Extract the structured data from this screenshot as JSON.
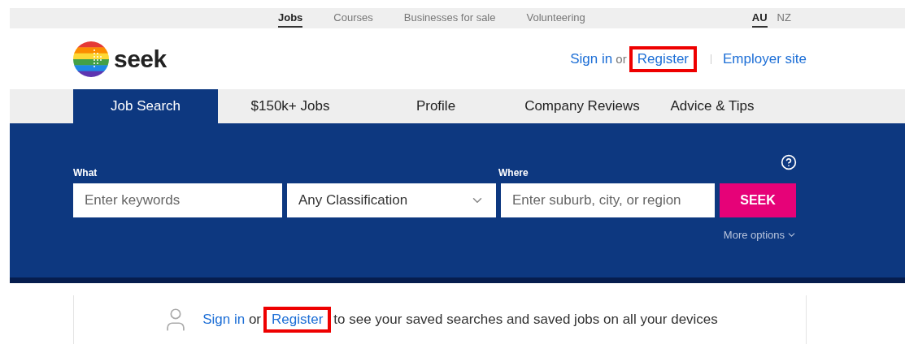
{
  "top_nav": {
    "items": [
      {
        "label": "Jobs",
        "selected": true
      },
      {
        "label": "Courses",
        "selected": false
      },
      {
        "label": "Businesses for sale",
        "selected": false
      },
      {
        "label": "Volunteering",
        "selected": false
      }
    ],
    "regions": [
      {
        "label": "AU",
        "selected": true
      },
      {
        "label": "NZ",
        "selected": false
      }
    ]
  },
  "header": {
    "logo": "seek",
    "sign_in": "Sign in",
    "or": "or",
    "register": "Register",
    "register_highlighted": true,
    "employer": "Employer site"
  },
  "tabs": [
    {
      "label": "Job Search",
      "selected": true
    },
    {
      "label": "$150k+ Jobs",
      "selected": false
    },
    {
      "label": "Profile",
      "selected": false
    },
    {
      "label": "Company Reviews",
      "selected": false
    },
    {
      "label": "Advice & Tips",
      "selected": false
    }
  ],
  "search": {
    "what_label": "What",
    "keywords_placeholder": "Enter keywords",
    "classification": "Any Classification",
    "where_label": "Where",
    "where_placeholder": "Enter suburb, city, or region",
    "button": "SEEK",
    "more_options": "More options"
  },
  "banner": {
    "sign_in": "Sign in",
    "or": "or",
    "register": "Register",
    "register_highlighted": true,
    "rest": "to see your saved searches and saved jobs on all your devices"
  }
}
